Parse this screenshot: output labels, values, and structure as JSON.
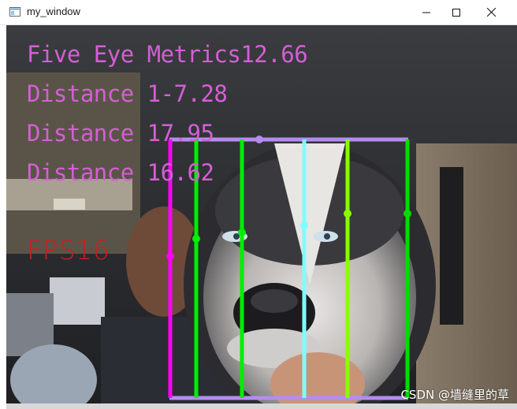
{
  "window": {
    "title": "my_window",
    "controls": [
      "minimize",
      "maximize",
      "close"
    ]
  },
  "overlay": {
    "metric_line": "Five Eye Metrics12.66",
    "distance1": "Distance 1-7.28",
    "distance2": "Distance 17.95",
    "distance3": "Distance 16.62",
    "fps": "FPS16",
    "metric_color": "#d45fd4",
    "fps_color": "#c81f1f"
  },
  "face_box": {
    "box_color": "#b48cf0",
    "line_colors": [
      "#ff00ff",
      "#00ee00",
      "#00ee00",
      "#7fffff",
      "#88ff00",
      "#00dd00"
    ]
  },
  "watermark": "CSDN @墙缝里的草"
}
